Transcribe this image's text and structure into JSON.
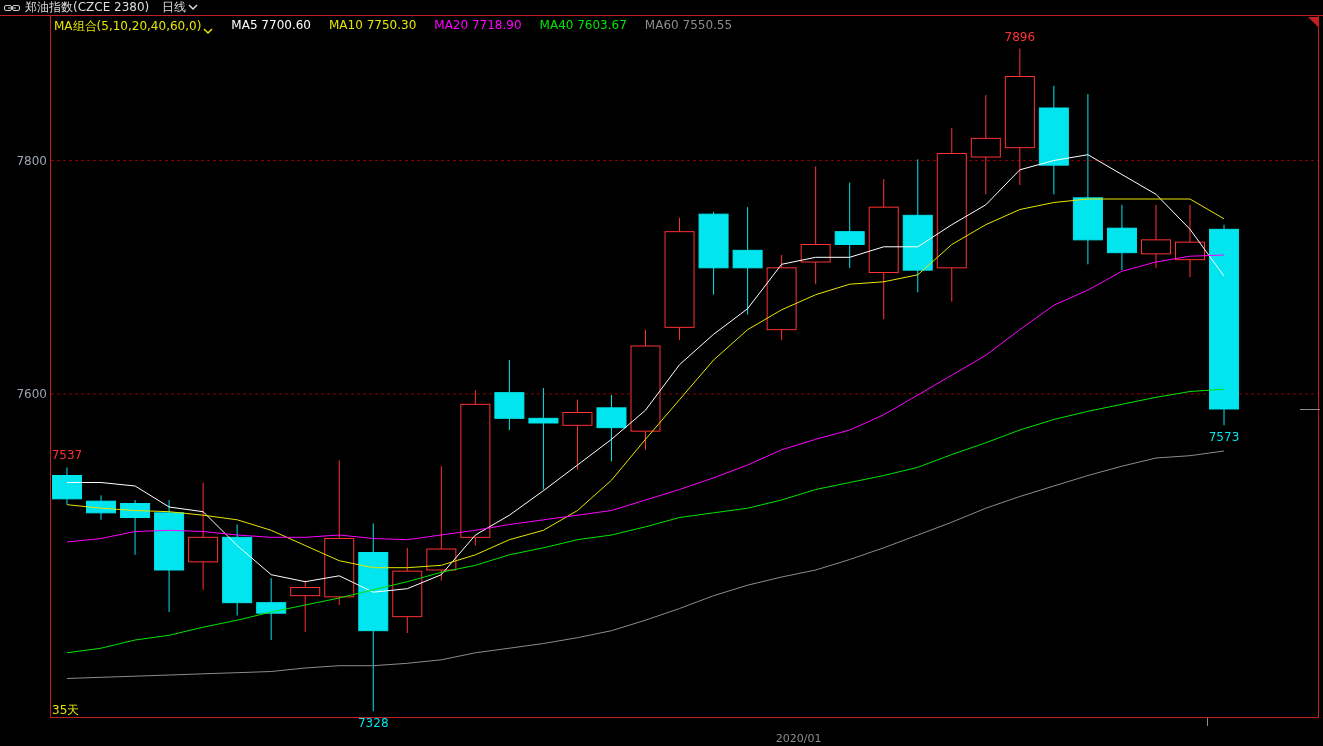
{
  "title_bar": {
    "symbol": "郑油指数(CZCE 2380)",
    "period": "日线"
  },
  "legend": {
    "indicator": "MA组合(5,10,20,40,60,0)",
    "readings": [
      "7700.60",
      "7750.30",
      "7718.90",
      "7603.67",
      "7550.55"
    ]
  },
  "period_count": "35天",
  "date_label": "2020/01",
  "chart_data": {
    "type": "line",
    "ylim": [
      7323,
      7923
    ],
    "yticks": [
      7600,
      7800
    ],
    "series": [
      {
        "name": "MA5",
        "color": "#ffffff",
        "values": [
          7524,
          7524,
          7521,
          7503,
          7499,
          7470,
          7445,
          7439,
          7444,
          7430,
          7433,
          7445,
          7479,
          7496,
          7517,
          7539,
          7561,
          7586,
          7625,
          7651,
          7673,
          7711,
          7717,
          7717,
          7726,
          7726,
          7745,
          7762,
          7792,
          7800,
          7805,
          7788,
          7771,
          7741,
          7701
        ]
      },
      {
        "name": "MA10",
        "color": "#e6e600",
        "values": [
          7505,
          7502,
          7500,
          7499,
          7496,
          7492,
          7483,
          7470,
          7457,
          7451,
          7451,
          7453,
          7462,
          7475,
          7483,
          7500,
          7526,
          7561,
          7595,
          7629,
          7655,
          7672,
          7685,
          7694,
          7696,
          7702,
          7728,
          7745,
          7758,
          7764,
          7767,
          7767,
          7767,
          7767,
          7750
        ]
      },
      {
        "name": "MA20",
        "color": "#ff00ff",
        "values": [
          7473,
          7476,
          7482,
          7483,
          7482,
          7479,
          7477,
          7477,
          7479,
          7476,
          7475,
          7479,
          7483,
          7488,
          7492,
          7496,
          7500,
          7509,
          7518,
          7528,
          7539,
          7552,
          7561,
          7569,
          7582,
          7599,
          7616,
          7633,
          7655,
          7676,
          7689,
          7705,
          7713,
          7718,
          7719
        ]
      },
      {
        "name": "MA40",
        "color": "#00e600",
        "values": [
          7378,
          7382,
          7389,
          7393,
          7400,
          7406,
          7413,
          7419,
          7425,
          7432,
          7439,
          7447,
          7453,
          7462,
          7468,
          7475,
          7479,
          7486,
          7494,
          7498,
          7502,
          7509,
          7518,
          7524,
          7530,
          7537,
          7548,
          7558,
          7569,
          7578,
          7585,
          7591,
          7597,
          7602,
          7604
        ]
      },
      {
        "name": "MA60",
        "color": "#8c8c8c",
        "values": [
          7356,
          7357,
          7358,
          7359,
          7360,
          7361,
          7362,
          7365,
          7367,
          7367,
          7369,
          7372,
          7378,
          7382,
          7386,
          7391,
          7397,
          7406,
          7416,
          7427,
          7436,
          7443,
          7449,
          7458,
          7468,
          7479,
          7490,
          7502,
          7512,
          7521,
          7530,
          7538,
          7545,
          7547,
          7551
        ]
      }
    ],
    "annotations": [
      "7537",
      "7896",
      "7573",
      "7328"
    ]
  }
}
